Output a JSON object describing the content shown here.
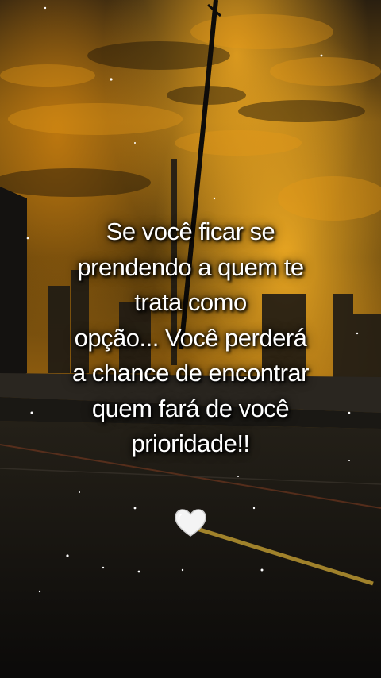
{
  "quote": {
    "lines": [
      "Se você ficar se",
      "prendendo a quem te",
      "trata como",
      "opção... Você perderá",
      "a chance de encontrar",
      "quem fará de você",
      "prioridade!!"
    ]
  },
  "emoji": {
    "name": "white-heart-icon"
  },
  "colors": {
    "sky_glow": "#e0940f",
    "sky_dark": "#1a1205",
    "text": "#ffffff",
    "road": "#121110"
  }
}
